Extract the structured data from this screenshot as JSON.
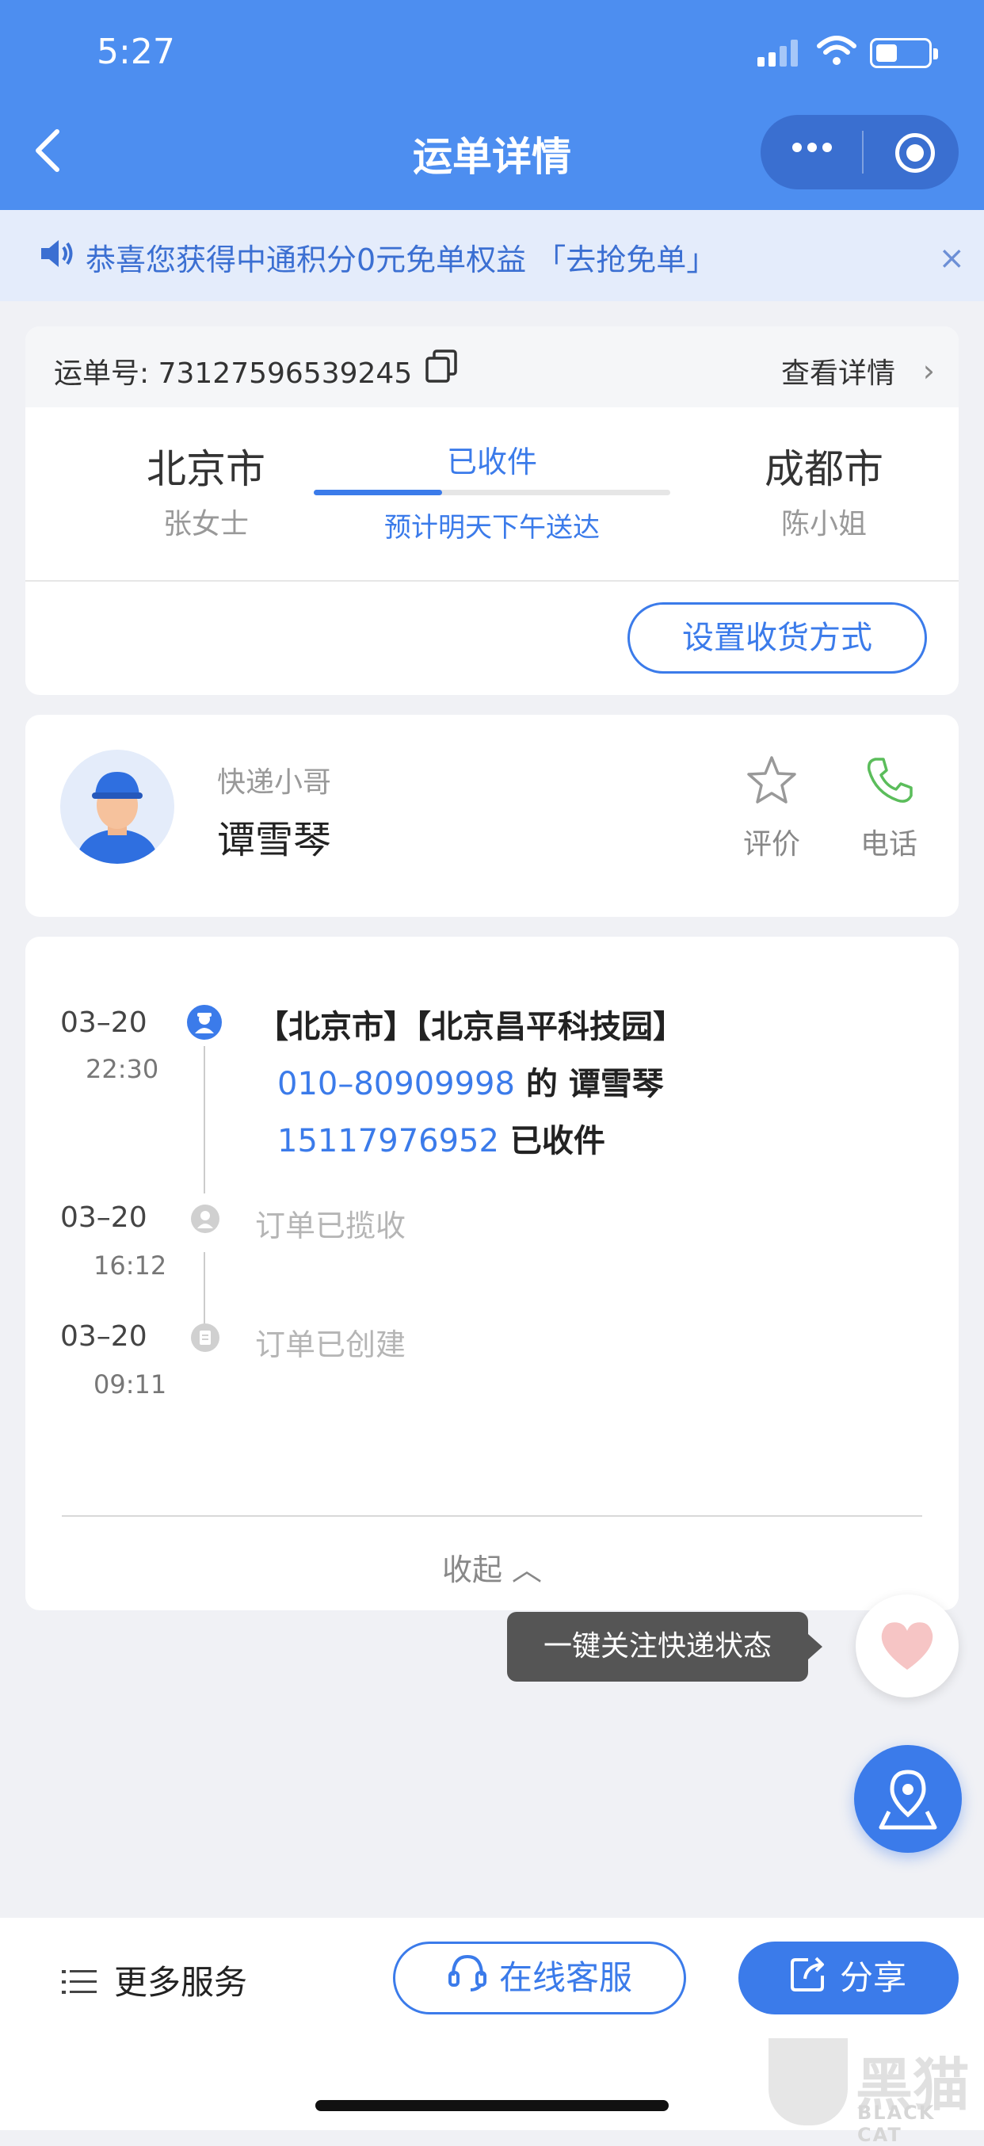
{
  "status_bar": {
    "time": "5:27"
  },
  "nav": {
    "title": "运单详情"
  },
  "notice": {
    "text": "恭喜您获得中通积分0元免单权益 「去抢免单」",
    "close": "×"
  },
  "waybill": {
    "label": "运单号: 73127596539245",
    "view_detail": "查看详情",
    "arrow": "›"
  },
  "route": {
    "from_city": "北京市",
    "from_person": "张女士",
    "status": "已收件",
    "eta": "预计明天下午送达",
    "to_city": "成都市",
    "to_person": "陈小姐",
    "progress": 0.36
  },
  "set_method_label": "设置收货方式",
  "courier": {
    "role": "快递小哥",
    "name": "谭雪琴",
    "rate_label": "评价",
    "phone_label": "电话"
  },
  "timeline": [
    {
      "date": "03–20",
      "time": "22:30",
      "line1": "【北京市】【北京昌平科技园】",
      "phone1": "010–80909998",
      "mid": " 的 谭雪琴",
      "phone2": "15117976952",
      "tail": " 已收件"
    },
    {
      "date": "03–20",
      "time": "16:12",
      "text": "订单已揽收"
    },
    {
      "date": "03–20",
      "time": "09:11",
      "text": "订单已创建"
    }
  ],
  "collapse_label": "收起 ︿",
  "tooltip": "一键关注快递状态",
  "bottom": {
    "more_services": "更多服务",
    "online_service": "在线客服",
    "share": "分享"
  },
  "watermark": {
    "cn": "黑猫",
    "en": "BLACK CAT"
  },
  "colors": {
    "primary": "#4d8ef0",
    "accent": "#3b7bea",
    "notice_bg": "#e4ecfb"
  }
}
